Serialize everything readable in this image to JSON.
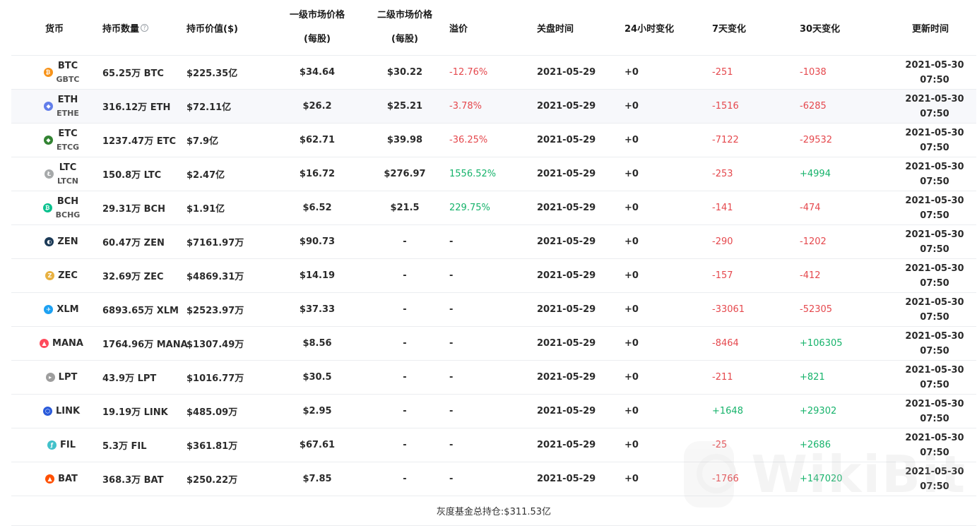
{
  "headers": {
    "coin": "货币",
    "holdings": "持币数量",
    "value": "持币价值($)",
    "primary_price": "一级市场价格",
    "primary_unit": "(每股)",
    "secondary_price": "二级市场价格",
    "secondary_unit": "(每股)",
    "premium": "溢价",
    "close_time": "关盘时间",
    "change_24h": "24小时变化",
    "change_7d": "7天变化",
    "change_30d": "30天变化",
    "update_time": "更新时间"
  },
  "rows": [
    {
      "coin": "BTC",
      "fund": "GBTC",
      "icon": "bitcoin-icon",
      "color": "#f7931a",
      "glyph": "₿",
      "holdings": "65.25万 BTC",
      "value": "$225.35亿",
      "primary": "$34.64",
      "secondary": "$30.22",
      "premium": "-12.76%",
      "premium_sign": "neg",
      "close": "2021-05-29",
      "c24": "+0",
      "c7": "-251",
      "c7_sign": "neg",
      "c30": "-1038",
      "c30_sign": "neg",
      "upd_date": "2021-05-30",
      "upd_time": "07:50"
    },
    {
      "coin": "ETH",
      "fund": "ETHE",
      "icon": "ethereum-icon",
      "color": "#627eea",
      "glyph": "◆",
      "holdings": "316.12万 ETH",
      "value": "$72.11亿",
      "primary": "$26.2",
      "secondary": "$25.21",
      "premium": "-3.78%",
      "premium_sign": "neg",
      "close": "2021-05-29",
      "c24": "+0",
      "c7": "-1516",
      "c7_sign": "neg",
      "c30": "-6285",
      "c30_sign": "neg",
      "upd_date": "2021-05-30",
      "upd_time": "07:50"
    },
    {
      "coin": "ETC",
      "fund": "ETCG",
      "icon": "ethereum-classic-icon",
      "color": "#328332",
      "glyph": "◆",
      "holdings": "1237.47万 ETC",
      "value": "$7.9亿",
      "primary": "$62.71",
      "secondary": "$39.98",
      "premium": "-36.25%",
      "premium_sign": "neg",
      "close": "2021-05-29",
      "c24": "+0",
      "c7": "-7122",
      "c7_sign": "neg",
      "c30": "-29532",
      "c30_sign": "neg",
      "upd_date": "2021-05-30",
      "upd_time": "07:50"
    },
    {
      "coin": "LTC",
      "fund": "LTCN",
      "icon": "litecoin-icon",
      "color": "#a6a9aa",
      "glyph": "Ł",
      "holdings": "150.8万 LTC",
      "value": "$2.47亿",
      "primary": "$16.72",
      "secondary": "$276.97",
      "premium": "1556.52%",
      "premium_sign": "pos",
      "close": "2021-05-29",
      "c24": "+0",
      "c7": "-253",
      "c7_sign": "neg",
      "c30": "+4994",
      "c30_sign": "pos",
      "upd_date": "2021-05-30",
      "upd_time": "07:50"
    },
    {
      "coin": "BCH",
      "fund": "BCHG",
      "icon": "bitcoin-cash-icon",
      "color": "#0ac18e",
      "glyph": "₿",
      "holdings": "29.31万 BCH",
      "value": "$1.91亿",
      "primary": "$6.52",
      "secondary": "$21.5",
      "premium": "229.75%",
      "premium_sign": "pos",
      "close": "2021-05-29",
      "c24": "+0",
      "c7": "-141",
      "c7_sign": "neg",
      "c30": "-474",
      "c30_sign": "neg",
      "upd_date": "2021-05-30",
      "upd_time": "07:50"
    },
    {
      "coin": "ZEN",
      "fund": "",
      "icon": "horizen-icon",
      "color": "#1b3a57",
      "glyph": "◐",
      "holdings": "60.47万 ZEN",
      "value": "$7161.97万",
      "primary": "$90.73",
      "secondary": "-",
      "premium": "-",
      "premium_sign": "none",
      "close": "2021-05-29",
      "c24": "+0",
      "c7": "-290",
      "c7_sign": "neg",
      "c30": "-1202",
      "c30_sign": "neg",
      "upd_date": "2021-05-30",
      "upd_time": "07:50"
    },
    {
      "coin": "ZEC",
      "fund": "",
      "icon": "zcash-icon",
      "color": "#e8b141",
      "glyph": "Z",
      "holdings": "32.69万 ZEC",
      "value": "$4869.31万",
      "primary": "$14.19",
      "secondary": "-",
      "premium": "-",
      "premium_sign": "none",
      "close": "2021-05-29",
      "c24": "+0",
      "c7": "-157",
      "c7_sign": "neg",
      "c30": "-412",
      "c30_sign": "neg",
      "upd_date": "2021-05-30",
      "upd_time": "07:50"
    },
    {
      "coin": "XLM",
      "fund": "",
      "icon": "stellar-icon",
      "color": "#1da1f2",
      "glyph": "✈",
      "holdings": "6893.65万 XLM",
      "value": "$2523.97万",
      "primary": "$37.33",
      "secondary": "-",
      "premium": "-",
      "premium_sign": "none",
      "close": "2021-05-29",
      "c24": "+0",
      "c7": "-33061",
      "c7_sign": "neg",
      "c30": "-52305",
      "c30_sign": "neg",
      "upd_date": "2021-05-30",
      "upd_time": "07:50"
    },
    {
      "coin": "MANA",
      "fund": "",
      "icon": "decentraland-icon",
      "color": "#ff4a5c",
      "glyph": "▲",
      "holdings": "1764.96万 MANA",
      "value": "$1307.49万",
      "primary": "$8.56",
      "secondary": "-",
      "premium": "-",
      "premium_sign": "none",
      "close": "2021-05-29",
      "c24": "+0",
      "c7": "-8464",
      "c7_sign": "neg",
      "c30": "+106305",
      "c30_sign": "pos",
      "upd_date": "2021-05-30",
      "upd_time": "07:50"
    },
    {
      "coin": "LPT",
      "fund": "",
      "icon": "livepeer-icon",
      "color": "#9e9e9e",
      "glyph": "▸",
      "holdings": "43.9万 LPT",
      "value": "$1016.77万",
      "primary": "$30.5",
      "secondary": "-",
      "premium": "-",
      "premium_sign": "none",
      "close": "2021-05-29",
      "c24": "+0",
      "c7": "-211",
      "c7_sign": "neg",
      "c30": "+821",
      "c30_sign": "pos",
      "upd_date": "2021-05-30",
      "upd_time": "07:50"
    },
    {
      "coin": "LINK",
      "fund": "",
      "icon": "chainlink-icon",
      "color": "#2a5ada",
      "glyph": "⬡",
      "holdings": "19.19万 LINK",
      "value": "$485.09万",
      "primary": "$2.95",
      "secondary": "-",
      "premium": "-",
      "premium_sign": "none",
      "close": "2021-05-29",
      "c24": "+0",
      "c7": "+1648",
      "c7_sign": "pos",
      "c30": "+29302",
      "c30_sign": "pos",
      "upd_date": "2021-05-30",
      "upd_time": "07:50"
    },
    {
      "coin": "FIL",
      "fund": "",
      "icon": "filecoin-icon",
      "color": "#42c1ca",
      "glyph": "ƒ",
      "holdings": "5.3万 FIL",
      "value": "$361.81万",
      "primary": "$67.61",
      "secondary": "-",
      "premium": "-",
      "premium_sign": "none",
      "close": "2021-05-29",
      "c24": "+0",
      "c7": "-25",
      "c7_sign": "neg",
      "c30": "+2686",
      "c30_sign": "pos",
      "upd_date": "2021-05-30",
      "upd_time": "07:50"
    },
    {
      "coin": "BAT",
      "fund": "",
      "icon": "basic-attention-token-icon",
      "color": "#ff5000",
      "glyph": "▲",
      "holdings": "368.3万 BAT",
      "value": "$250.22万",
      "primary": "$7.85",
      "secondary": "-",
      "premium": "-",
      "premium_sign": "none",
      "close": "2021-05-29",
      "c24": "+0",
      "c7": "-1766",
      "c7_sign": "neg",
      "c30": "+147020",
      "c30_sign": "pos",
      "upd_date": "2021-05-30",
      "upd_time": "07:50"
    }
  ],
  "footer": {
    "total": "灰度基金总持仓:$311.53亿"
  },
  "watermark": {
    "text": "WikiBit",
    "icon": "wikibit-logo-icon"
  },
  "colors": {
    "negative": "#e5484d",
    "positive": "#16b36b",
    "alt_row": "#f7f8fb",
    "border": "#ebedf0"
  }
}
